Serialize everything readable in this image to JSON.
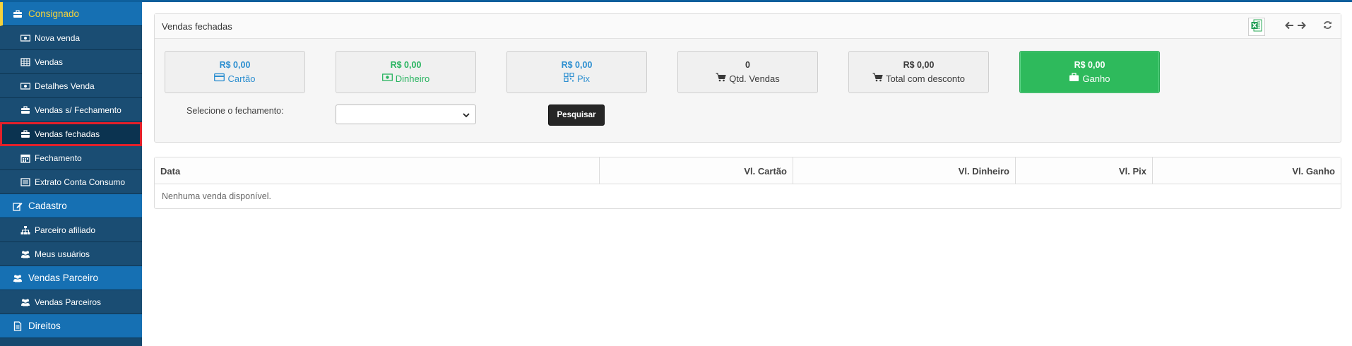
{
  "sidebar": {
    "items": [
      {
        "label": "Consignado",
        "type": "section",
        "active": true,
        "icon": "briefcase-icon"
      },
      {
        "label": "Nova venda",
        "type": "sub",
        "icon": "money-icon"
      },
      {
        "label": "Vendas",
        "type": "sub",
        "icon": "table-icon"
      },
      {
        "label": "Detalhes Venda",
        "type": "sub",
        "icon": "money-icon"
      },
      {
        "label": "Vendas s/ Fechamento",
        "type": "sub",
        "icon": "briefcase-icon"
      },
      {
        "label": "Vendas fechadas",
        "type": "sub",
        "selected": true,
        "icon": "briefcase-icon"
      },
      {
        "label": "Fechamento",
        "type": "sub",
        "icon": "calendar-icon"
      },
      {
        "label": "Extrato Conta Consumo",
        "type": "sub",
        "icon": "list-icon"
      },
      {
        "label": "Cadastro",
        "type": "section",
        "icon": "edit-icon"
      },
      {
        "label": "Parceiro afiliado",
        "type": "sub",
        "icon": "sitemap-icon"
      },
      {
        "label": "Meus usuários",
        "type": "sub",
        "icon": "users-icon"
      },
      {
        "label": "Vendas Parceiro",
        "type": "section",
        "icon": "users-icon"
      },
      {
        "label": "Vendas Parceiros",
        "type": "sub",
        "icon": "users-icon"
      },
      {
        "label": "Direitos",
        "type": "section",
        "icon": "document-icon"
      }
    ]
  },
  "panel": {
    "title": "Vendas fechadas",
    "stats": [
      {
        "value": "R$ 0,00",
        "label": "Cartão",
        "color": "#2d8fd0",
        "icon": "credit-card-icon"
      },
      {
        "value": "R$ 0,00",
        "label": "Dinheiro",
        "color": "#29b460",
        "icon": "money-icon"
      },
      {
        "value": "R$ 0,00",
        "label": "Pix",
        "color": "#2d8fd0",
        "icon": "qrcode-icon"
      },
      {
        "value": "0",
        "label": "Qtd. Vendas",
        "color": "#3a3a3a",
        "icon": "cart-icon"
      },
      {
        "value": "R$ 0,00",
        "label": "Total com desconto",
        "color": "#3a3a3a",
        "icon": "cart-icon"
      },
      {
        "value": "R$ 0,00",
        "label": "Ganho",
        "color": "#ffffff",
        "icon": "briefcase-icon"
      }
    ],
    "select_label": "Selecione o fechamento:",
    "select_value": "",
    "search_label": "Pesquisar"
  },
  "table": {
    "columns": [
      "Data",
      "Vl. Cartão",
      "Vl. Dinheiro",
      "Vl. Pix",
      "Vl. Ganho"
    ],
    "empty_message": "Nenhuma venda disponível."
  }
}
